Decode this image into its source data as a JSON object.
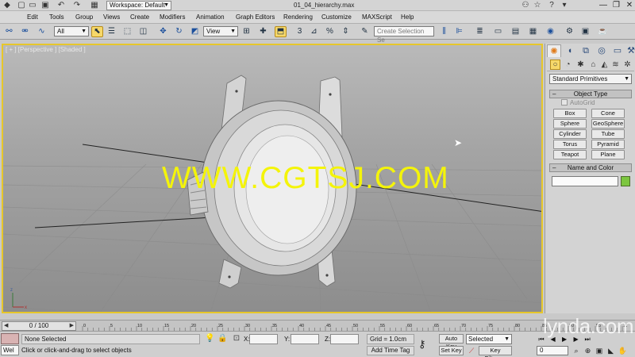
{
  "window": {
    "doc_title": "01_04_hierarchy.max",
    "workspace": "Workspace: Default",
    "quick_access_icons": [
      "app-logo-icon",
      "new-file-icon",
      "open-file-icon",
      "save-file-icon",
      "undo-icon",
      "redo-icon",
      "hold-icon"
    ],
    "controls": {
      "minimize": "—",
      "maximize": "❐",
      "close": "✕"
    }
  },
  "menubar": {
    "items": [
      "Edit",
      "Tools",
      "Group",
      "Views",
      "Create",
      "Modifiers",
      "Animation",
      "Graph Editors",
      "Rendering",
      "Customize",
      "MAXScript",
      "Help"
    ]
  },
  "toolbar": {
    "selection_filter": "All",
    "ref_coord": "View",
    "named_selection_placeholder": "Create Selection Se"
  },
  "viewport": {
    "label": "[ + ] [Perspective ] [Shaded ]",
    "watermark": "WWW.CGTSJ.COM",
    "border_color": "#e7c72a"
  },
  "command_panel": {
    "category": "Standard Primitives",
    "object_type_header": "Object Type",
    "autogrid": "AutoGrid",
    "buttons": [
      "Box",
      "Cone",
      "Sphere",
      "GeoSphere",
      "Cylinder",
      "Tube",
      "Torus",
      "Pyramid",
      "Teapot",
      "Plane"
    ],
    "name_color_header": "Name and Color",
    "object_color": "#7cc63f"
  },
  "timeline": {
    "slider": "0 / 100",
    "ticks": [
      "0",
      "5",
      "10",
      "15",
      "20",
      "25",
      "30",
      "35",
      "40",
      "45",
      "50",
      "55",
      "60",
      "65",
      "70",
      "75",
      "80",
      "85",
      "90",
      "95",
      "100"
    ]
  },
  "statusbar": {
    "listener": "Wel",
    "selection_status": "None Selected",
    "prompt": "Click or click-and-drag to select objects",
    "x_label": "X:",
    "y_label": "Y:",
    "z_label": "Z:",
    "grid": "Grid = 1.0cm",
    "add_time_tag": "Add Time Tag",
    "auto_key": "Auto Key",
    "set_key": "Set Key",
    "selected": "Selected",
    "key_filters": "Key Filters...",
    "frame": "0",
    "watermark": "lynda.com"
  }
}
